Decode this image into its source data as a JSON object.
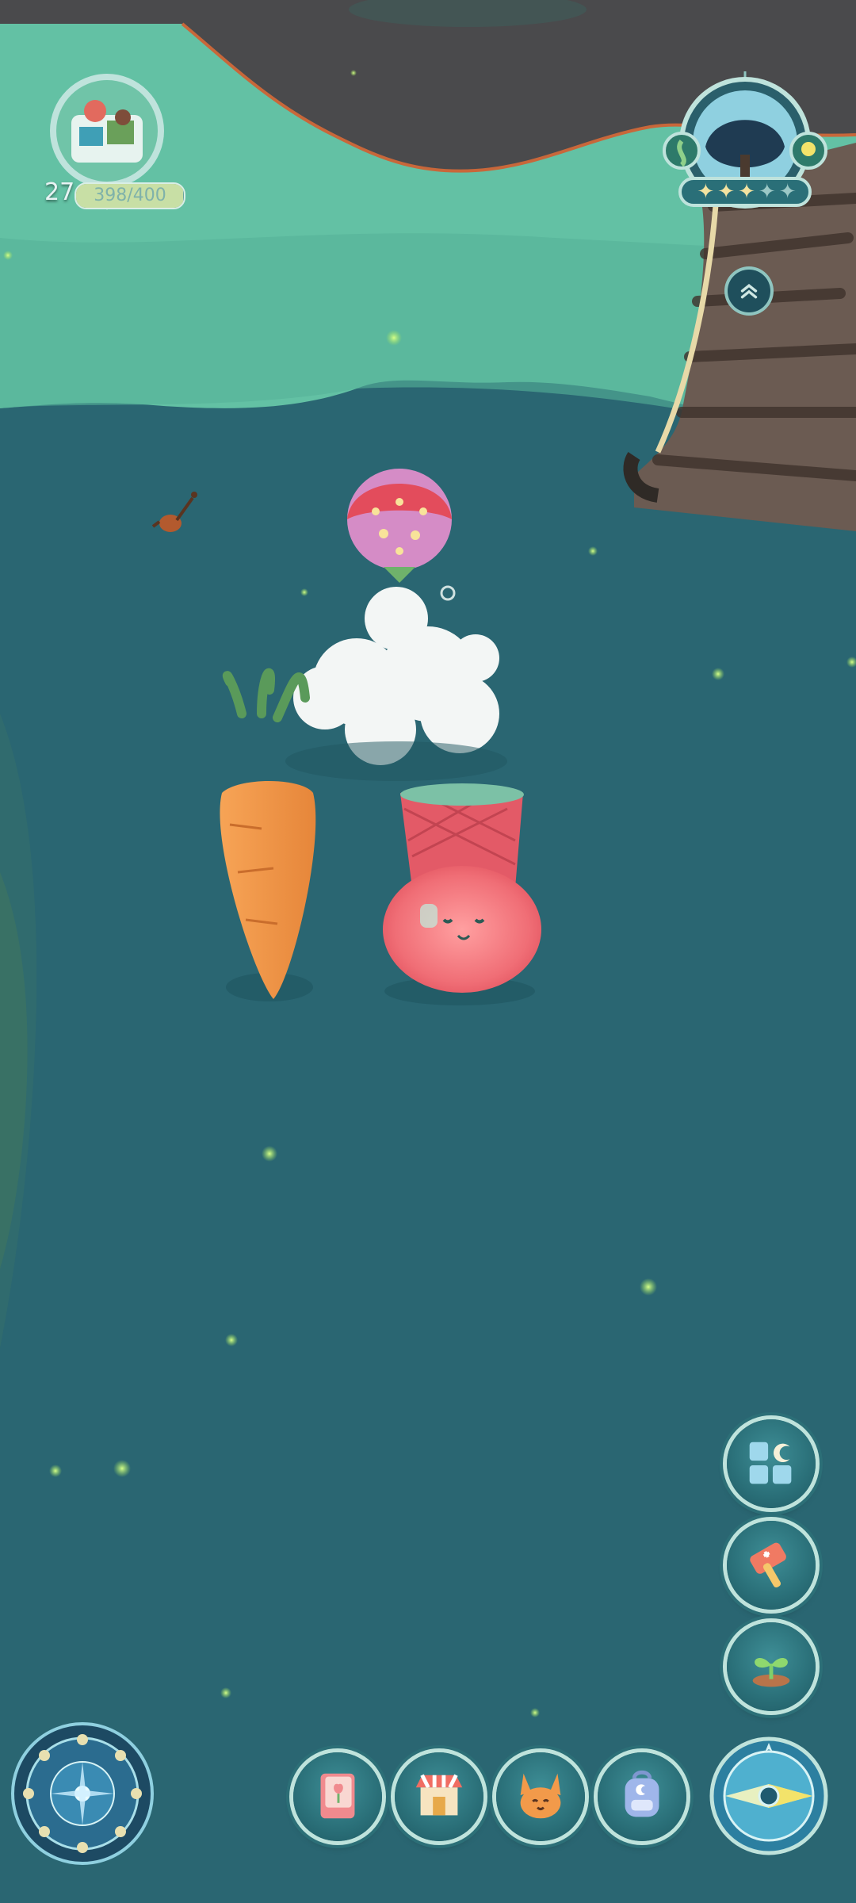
{
  "player": {
    "level": "27",
    "xp_text": "398/400",
    "xp_fraction": 0.995
  },
  "season_widget": {
    "stars_filled": 3,
    "stars_total": 5
  },
  "icons": {
    "avatar": "island-garden-avatar-icon",
    "season": "tree-season-icon",
    "expand": "chevron-up-icon",
    "menu1": "grid-moon-icon",
    "menu2": "hammer-icon",
    "menu3": "sprout-icon",
    "compass": "moon-compass-icon",
    "book": "flower-book-icon",
    "shop": "shop-icon",
    "character": "fox-icon",
    "backpack": "backpack-icon",
    "nav": "navigation-compass-icon"
  },
  "colors": {
    "water": "#2a6672",
    "sky_green": "#63c1a4",
    "hud_teal": "#2a6f78",
    "hud_rim": "#bfe3dc",
    "star": "#f3e3a0",
    "carrot": "#f29a4a",
    "pot": "#e96c74"
  }
}
